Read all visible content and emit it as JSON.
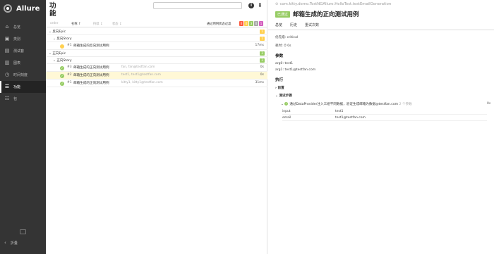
{
  "app": {
    "title": "Allure"
  },
  "sidebar": {
    "items": [
      {
        "label": "总览",
        "icon": "home-icon",
        "glyph": "⌂"
      },
      {
        "label": "类别",
        "icon": "briefcase-icon",
        "glyph": "▣"
      },
      {
        "label": "测试套",
        "icon": "suites-icon",
        "glyph": "▤"
      },
      {
        "label": "图表",
        "icon": "chart-icon",
        "glyph": "▥"
      },
      {
        "label": "时间刻度",
        "icon": "clock-icon",
        "glyph": "◷"
      },
      {
        "label": "功能",
        "icon": "behaviors-icon",
        "glyph": "☰",
        "active": true
      },
      {
        "label": "包",
        "icon": "packages-icon",
        "glyph": "☷"
      }
    ],
    "collapse_label": "折叠"
  },
  "middle": {
    "title": "功能",
    "toolbar": {
      "order": "order",
      "name": "名称",
      "duration": "持续",
      "status": "状态",
      "filter_label": "通过用例状态过滤",
      "chips": [
        {
          "value": "0",
          "color": "#fd5a3e"
        },
        {
          "value": "0",
          "color": "#ffd050"
        },
        {
          "value": "3",
          "color": "#97cc64"
        },
        {
          "value": "0",
          "color": "#aaaaaa"
        },
        {
          "value": "1",
          "color": "#d35ebe"
        }
      ]
    },
    "groups": [
      {
        "label": "反向Epic",
        "count": "1",
        "color": "#ffd050",
        "story": {
          "label": "反向Story",
          "count": "1",
          "color": "#ffd050"
        },
        "rows": [
          {
            "num": "#1",
            "name": "邮箱生成的反向测试用例",
            "params": "",
            "duration": "17ms",
            "status": "yellow"
          }
        ]
      },
      {
        "label": "正向Epic",
        "count": "3",
        "color": "#97cc64",
        "story": {
          "label": "正向Story",
          "count": "3",
          "color": "#97cc64"
        },
        "rows": [
          {
            "num": "#3",
            "name": "邮箱生成的正向测试用例",
            "params": "fan, fan@testfan.com",
            "duration": "0s",
            "status": "green"
          },
          {
            "num": "#2",
            "name": "邮箱生成的正向测试用例",
            "params": "test1, test1@testfan.com",
            "duration": "0s",
            "status": "green",
            "selected": true
          },
          {
            "num": "#1",
            "name": "邮箱生成的正向测试用例",
            "params": "kitty1, kitty1@testfan.com",
            "duration": "31ms",
            "status": "green"
          }
        ]
      }
    ]
  },
  "detail": {
    "path": "com.kitty.demo.TestNGAllure.HelloTest.testEmailGeneration",
    "badge": "已通过",
    "title": "邮箱生成的正向测试用例",
    "tabs": [
      "总览",
      "历史",
      "重试次数"
    ],
    "severity": "优先级: critical",
    "duration": "耗时: ⏱ 0s",
    "params_heading": "参数",
    "params": [
      "arg0: test1",
      "arg1: test1@testfan.com"
    ],
    "exec_heading": "执行",
    "before": "前置",
    "test_body": "测试步骤",
    "step": {
      "text": "通过DataProvider注入三组不同数据，验证生成邮箱为数据@testfan.com",
      "meta": "2 个参数",
      "duration": "0s",
      "params": [
        {
          "name": "input",
          "value": "test1"
        },
        {
          "name": "email",
          "value": "test1@testfan.com"
        }
      ]
    }
  }
}
